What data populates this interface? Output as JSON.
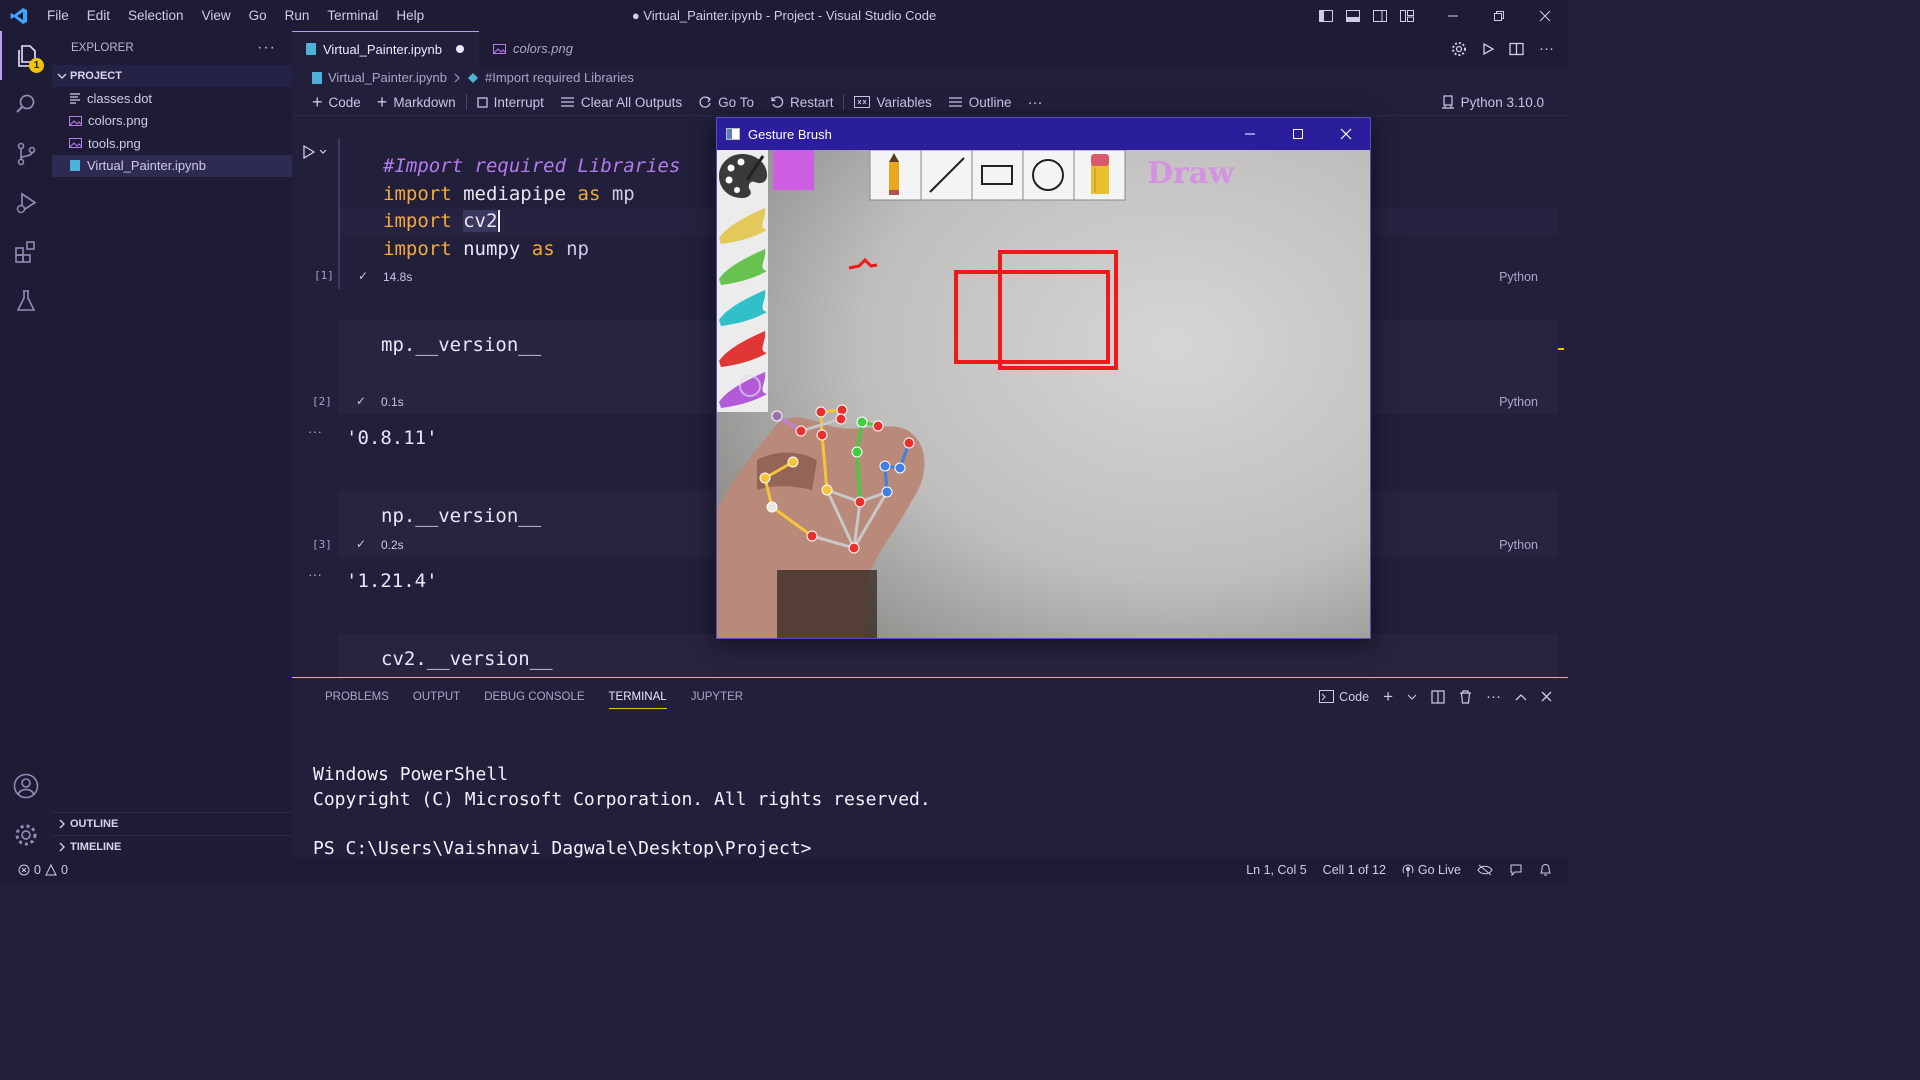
{
  "window": {
    "title": "● Virtual_Painter.ipynb - Project - Visual Studio Code",
    "menu": [
      "File",
      "Edit",
      "Selection",
      "View",
      "Go",
      "Run",
      "Terminal",
      "Help"
    ]
  },
  "activity": {
    "explorer_badge": "1"
  },
  "sidebar": {
    "title": "EXPLORER",
    "section": "PROJECT",
    "files": [
      {
        "name": "classes.dot",
        "icon": "text-file-icon"
      },
      {
        "name": "colors.png",
        "icon": "image-file-icon"
      },
      {
        "name": "tools.png",
        "icon": "image-file-icon"
      },
      {
        "name": "Virtual_Painter.ipynb",
        "icon": "notebook-file-icon",
        "selected": true
      }
    ],
    "outline": "OUTLINE",
    "timeline": "TIMELINE"
  },
  "tabs": [
    {
      "label": "Virtual_Painter.ipynb",
      "active": true,
      "modified": true
    },
    {
      "label": "colors.png",
      "active": false
    }
  ],
  "breadcrumb": {
    "file": "Virtual_Painter.ipynb",
    "symbol": "#Import required Libraries"
  },
  "nb_toolbar": {
    "code": "Code",
    "markdown": "Markdown",
    "interrupt": "Interrupt",
    "clear": "Clear All Outputs",
    "goto": "Go To",
    "restart": "Restart",
    "variables": "Variables",
    "outline": "Outline",
    "kernel": "Python 3.10.0"
  },
  "cells": {
    "c1": {
      "exec": "[1]",
      "time": "14.8s",
      "lang": "Python",
      "comment": "#Import required Libraries",
      "kw": "import",
      "l2_mod": "mediapipe",
      "l2_as": "as",
      "l2_alias": "mp",
      "l3_mod": "cv2",
      "l4_mod": "numpy",
      "l4_as": "as",
      "l4_alias": "np"
    },
    "c2": {
      "exec": "[2]",
      "time": "0.1s",
      "lang": "Python",
      "code": "mp.__version__",
      "output": "'0.8.11'"
    },
    "c3": {
      "exec": "[3]",
      "time": "0.2s",
      "lang": "Python",
      "code": "np.__version__",
      "output": "'1.21.4'"
    },
    "c4": {
      "code": "cv2.__version__"
    }
  },
  "panel": {
    "tabs": [
      "PROBLEMS",
      "OUTPUT",
      "DEBUG CONSOLE",
      "TERMINAL",
      "JUPYTER"
    ],
    "active": "TERMINAL",
    "shell_label": "Code",
    "terminal": {
      "line1": "Windows PowerShell",
      "line2": "Copyright (C) Microsoft Corporation. All rights reserved.",
      "prompt": "PS C:\\Users\\Vaishnavi Dagwale\\Desktop\\Project>"
    }
  },
  "status": {
    "errors": "0",
    "warnings": "0",
    "position": "Ln 1, Col 5",
    "cell": "Cell 1 of 12",
    "golive": "Go Live"
  },
  "gesture_window": {
    "title": "Gesture Brush",
    "mode_label": "Draw",
    "selected_color": "#cf5fe2",
    "palette": [
      "#e2c95a",
      "#67c24f",
      "#2fc0c9",
      "#e03636",
      "#b25ad8"
    ],
    "tools": [
      "pencil",
      "line",
      "rectangle",
      "circle",
      "eraser"
    ],
    "stroke_color": "#f01818"
  },
  "colors": {
    "accent": "#b79ef7",
    "keyword": "#f4a93a",
    "comment": "#b57af0",
    "warning": "#f0c400"
  }
}
